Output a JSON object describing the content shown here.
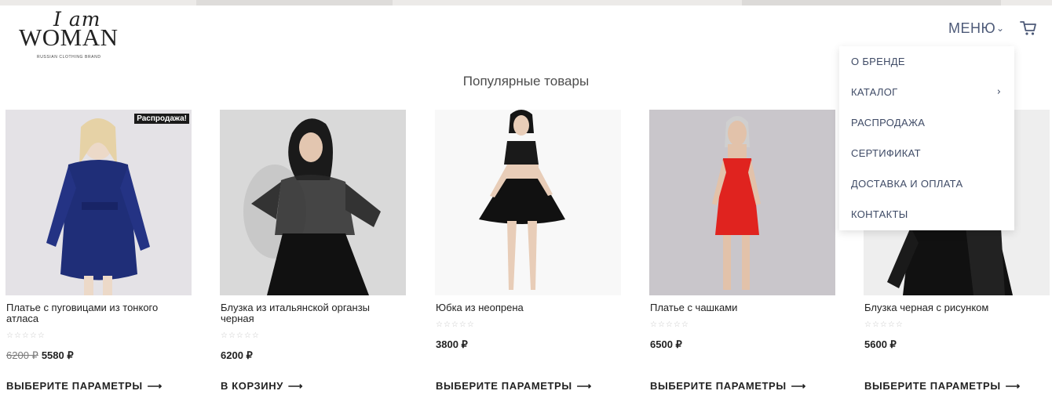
{
  "brand": {
    "script": "I am",
    "word": "WOMAN",
    "tagline": "RUSSIAN CLOTHING BRAND"
  },
  "header": {
    "menu_label": "МЕНЮ"
  },
  "menu": {
    "items": [
      "О БРЕНДЕ",
      "КАТАЛОГ",
      "РАСПРОДАЖА",
      "СЕРТИФИКАТ",
      "ДОСТАВКА И ОПЛАТА",
      "КОНТАКТЫ"
    ]
  },
  "section": {
    "title": "Популярные товары"
  },
  "colors": {
    "accent": "#4a5a80"
  },
  "products": [
    {
      "name": "Платье с пуговицами из тонкого атласа",
      "badge": "Распродажа!",
      "old_price": "6200 ₽",
      "price": "5580 ₽",
      "cta": "ВЫБЕРИТЕ ПАРАМЕТРЫ",
      "rating": 0
    },
    {
      "name": "Блузка из итальянской органзы черная",
      "price": "6200 ₽",
      "cta": "В КОРЗИНУ",
      "rating": 0
    },
    {
      "name": "Юбка из неопрена",
      "price": "3800 ₽",
      "cta": "ВЫБЕРИТЕ ПАРАМЕТРЫ",
      "rating": 0
    },
    {
      "name": "Платье с чашками",
      "price": "6500 ₽",
      "cta": "ВЫБЕРИТЕ ПАРАМЕТРЫ",
      "rating": 0
    },
    {
      "name": "Блузка черная с рисунком",
      "price": "5600 ₽",
      "cta": "ВЫБЕРИТЕ ПАРАМЕТРЫ",
      "rating": 0
    }
  ]
}
